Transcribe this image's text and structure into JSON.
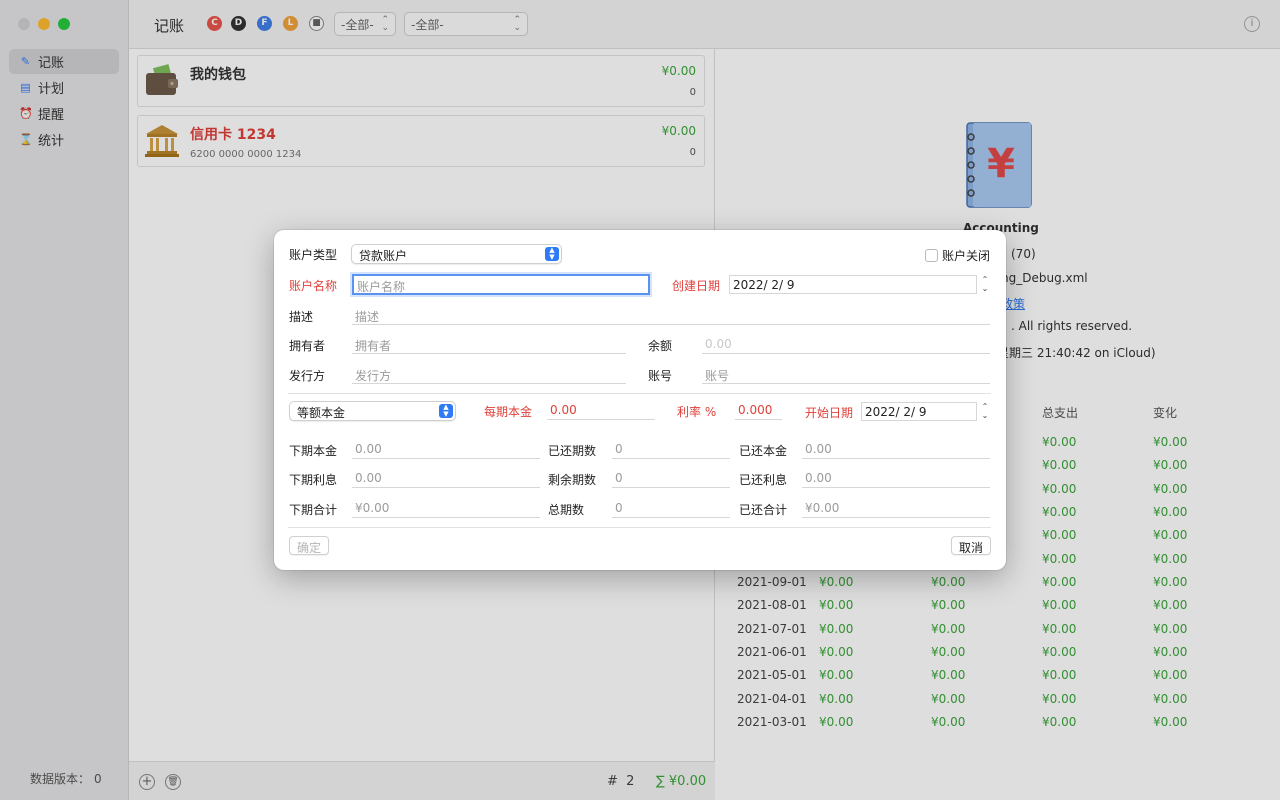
{
  "sidebar": {
    "items": [
      {
        "label": "记账",
        "icon": "edit-icon"
      },
      {
        "label": "计划",
        "icon": "calendar-icon"
      },
      {
        "label": "提醒",
        "icon": "alarm-icon"
      },
      {
        "label": "统计",
        "icon": "hourglass-icon"
      }
    ],
    "data_version_label": "数据版本：",
    "data_version_value": "0"
  },
  "toolbar": {
    "title": "记账",
    "filters": [
      {
        "letter": "C",
        "color": "#e9544a"
      },
      {
        "letter": "D",
        "color": "#333333"
      },
      {
        "letter": "F",
        "color": "#3f7fe8"
      },
      {
        "letter": "L",
        "color": "#f0a23a"
      }
    ],
    "select1": "-全部-",
    "select2": "-全部-"
  },
  "accounts": [
    {
      "name": "我的钱包",
      "sub": "",
      "amount": "¥0.00",
      "count": "0",
      "name_color": "#333333"
    },
    {
      "name": "信用卡 1234",
      "sub": "6200 0000 0000 1234",
      "amount": "¥0.00",
      "count": "0",
      "name_color": "#e0403a"
    }
  ],
  "footer": {
    "count_icon": "#",
    "count": "2",
    "sum_icon": "∑",
    "sum": "¥0.00"
  },
  "about": {
    "app_name": "Accounting",
    "line1": "(70)",
    "line2": "ng_Debug.xml",
    "link": "政策",
    "line4": ". All rights reserved.",
    "line5": "星期三 21:40:42 on iCloud)"
  },
  "stats": {
    "headers": [
      "总支出",
      "变化"
    ],
    "top_rows": [
      [
        "¥0.00",
        "¥0.00"
      ],
      [
        "¥0.00",
        "¥0.00"
      ],
      [
        "¥0.00",
        "¥0.00"
      ],
      [
        "¥0.00",
        "¥0.00"
      ],
      [
        "¥0.00",
        "¥0.00"
      ],
      [
        "¥0.00",
        "¥0.00"
      ]
    ],
    "rows": [
      {
        "date": "2021-09-01",
        "a": "¥0.00",
        "b": "¥0.00",
        "c": "¥0.00",
        "d": "¥0.00"
      },
      {
        "date": "2021-08-01",
        "a": "¥0.00",
        "b": "¥0.00",
        "c": "¥0.00",
        "d": "¥0.00"
      },
      {
        "date": "2021-07-01",
        "a": "¥0.00",
        "b": "¥0.00",
        "c": "¥0.00",
        "d": "¥0.00"
      },
      {
        "date": "2021-06-01",
        "a": "¥0.00",
        "b": "¥0.00",
        "c": "¥0.00",
        "d": "¥0.00"
      },
      {
        "date": "2021-05-01",
        "a": "¥0.00",
        "b": "¥0.00",
        "c": "¥0.00",
        "d": "¥0.00"
      },
      {
        "date": "2021-04-01",
        "a": "¥0.00",
        "b": "¥0.00",
        "c": "¥0.00",
        "d": "¥0.00"
      },
      {
        "date": "2021-03-01",
        "a": "¥0.00",
        "b": "¥0.00",
        "c": "¥0.00",
        "d": "¥0.00"
      }
    ]
  },
  "dialog": {
    "account_type_label": "账户类型",
    "account_type_value": "贷款账户",
    "account_closed_label": "账户关闭",
    "account_name_label": "账户名称",
    "account_name_placeholder": "账户名称",
    "created_date_label": "创建日期",
    "created_date_value": "2022/  2/  9",
    "description_label": "描述",
    "description_placeholder": "描述",
    "owner_label": "拥有者",
    "owner_placeholder": "拥有者",
    "balance_label": "余额",
    "balance_placeholder": "0.00",
    "issuer_label": "发行方",
    "issuer_placeholder": "发行方",
    "account_no_label": "账号",
    "account_no_placeholder": "账号",
    "repayment_type_value": "等额本金",
    "period_principal_label": "每期本金",
    "period_principal_value": "0.00",
    "rate_label": "利率 %",
    "rate_value": "0.000",
    "start_date_label": "开始日期",
    "start_date_value": "2022/  2/  9",
    "next_principal_label": "下期本金",
    "next_principal_value": "0.00",
    "paid_periods_label": "已还期数",
    "paid_periods_value": "0",
    "paid_principal_label": "已还本金",
    "paid_principal_value": "0.00",
    "next_interest_label": "下期利息",
    "next_interest_value": "0.00",
    "remaining_periods_label": "剩余期数",
    "remaining_periods_value": "0",
    "paid_interest_label": "已还利息",
    "paid_interest_value": "0.00",
    "next_total_label": "下期合计",
    "next_total_value": "¥0.00",
    "total_periods_label": "总期数",
    "total_periods_value": "0",
    "paid_total_label": "已还合计",
    "paid_total_value": "¥0.00",
    "confirm_label": "确定",
    "cancel_label": "取消"
  }
}
